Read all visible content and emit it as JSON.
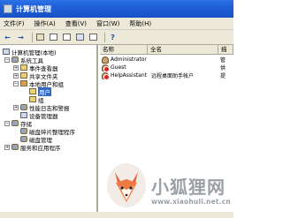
{
  "window": {
    "title": "计算机管理"
  },
  "menubar": {
    "items": [
      "文件(F)",
      "操作(A)",
      "查看(V)",
      "窗口(W)",
      "帮助(H)"
    ]
  },
  "toolbar": {
    "buttons": [
      "back-icon",
      "forward-icon",
      "up-icon",
      "show-tree-icon",
      "properties-icon",
      "refresh-icon",
      "export-icon",
      "help-icon"
    ]
  },
  "tree": {
    "root": "计算机管理(本地)",
    "items": [
      {
        "label": "系统工具"
      },
      {
        "label": "事件查看器"
      },
      {
        "label": "共享文件夹"
      },
      {
        "label": "本地用户和组"
      },
      {
        "label": "用户"
      },
      {
        "label": "组"
      },
      {
        "label": "性能日志和警报"
      },
      {
        "label": "设备管理器"
      },
      {
        "label": "存储"
      },
      {
        "label": "磁盘碎片整理程序"
      },
      {
        "label": "磁盘管理"
      },
      {
        "label": "服务和应用程序"
      }
    ]
  },
  "list": {
    "columns": [
      "名称",
      "全名",
      "描"
    ],
    "rows": [
      {
        "name": "Administrator",
        "fullname": "",
        "desc": "管"
      },
      {
        "name": "Guest",
        "fullname": "",
        "desc": "供"
      },
      {
        "name": "HelpAssistant",
        "fullname": "远程桌面助手帐户",
        "desc": "提"
      }
    ]
  },
  "watermark": {
    "text": "小狐狸网",
    "url": "www.xiaohuli.net.cn"
  },
  "colors": {
    "title": "#1f5fd6",
    "selected": "#316ac5",
    "chrome": "#ece9d8"
  }
}
